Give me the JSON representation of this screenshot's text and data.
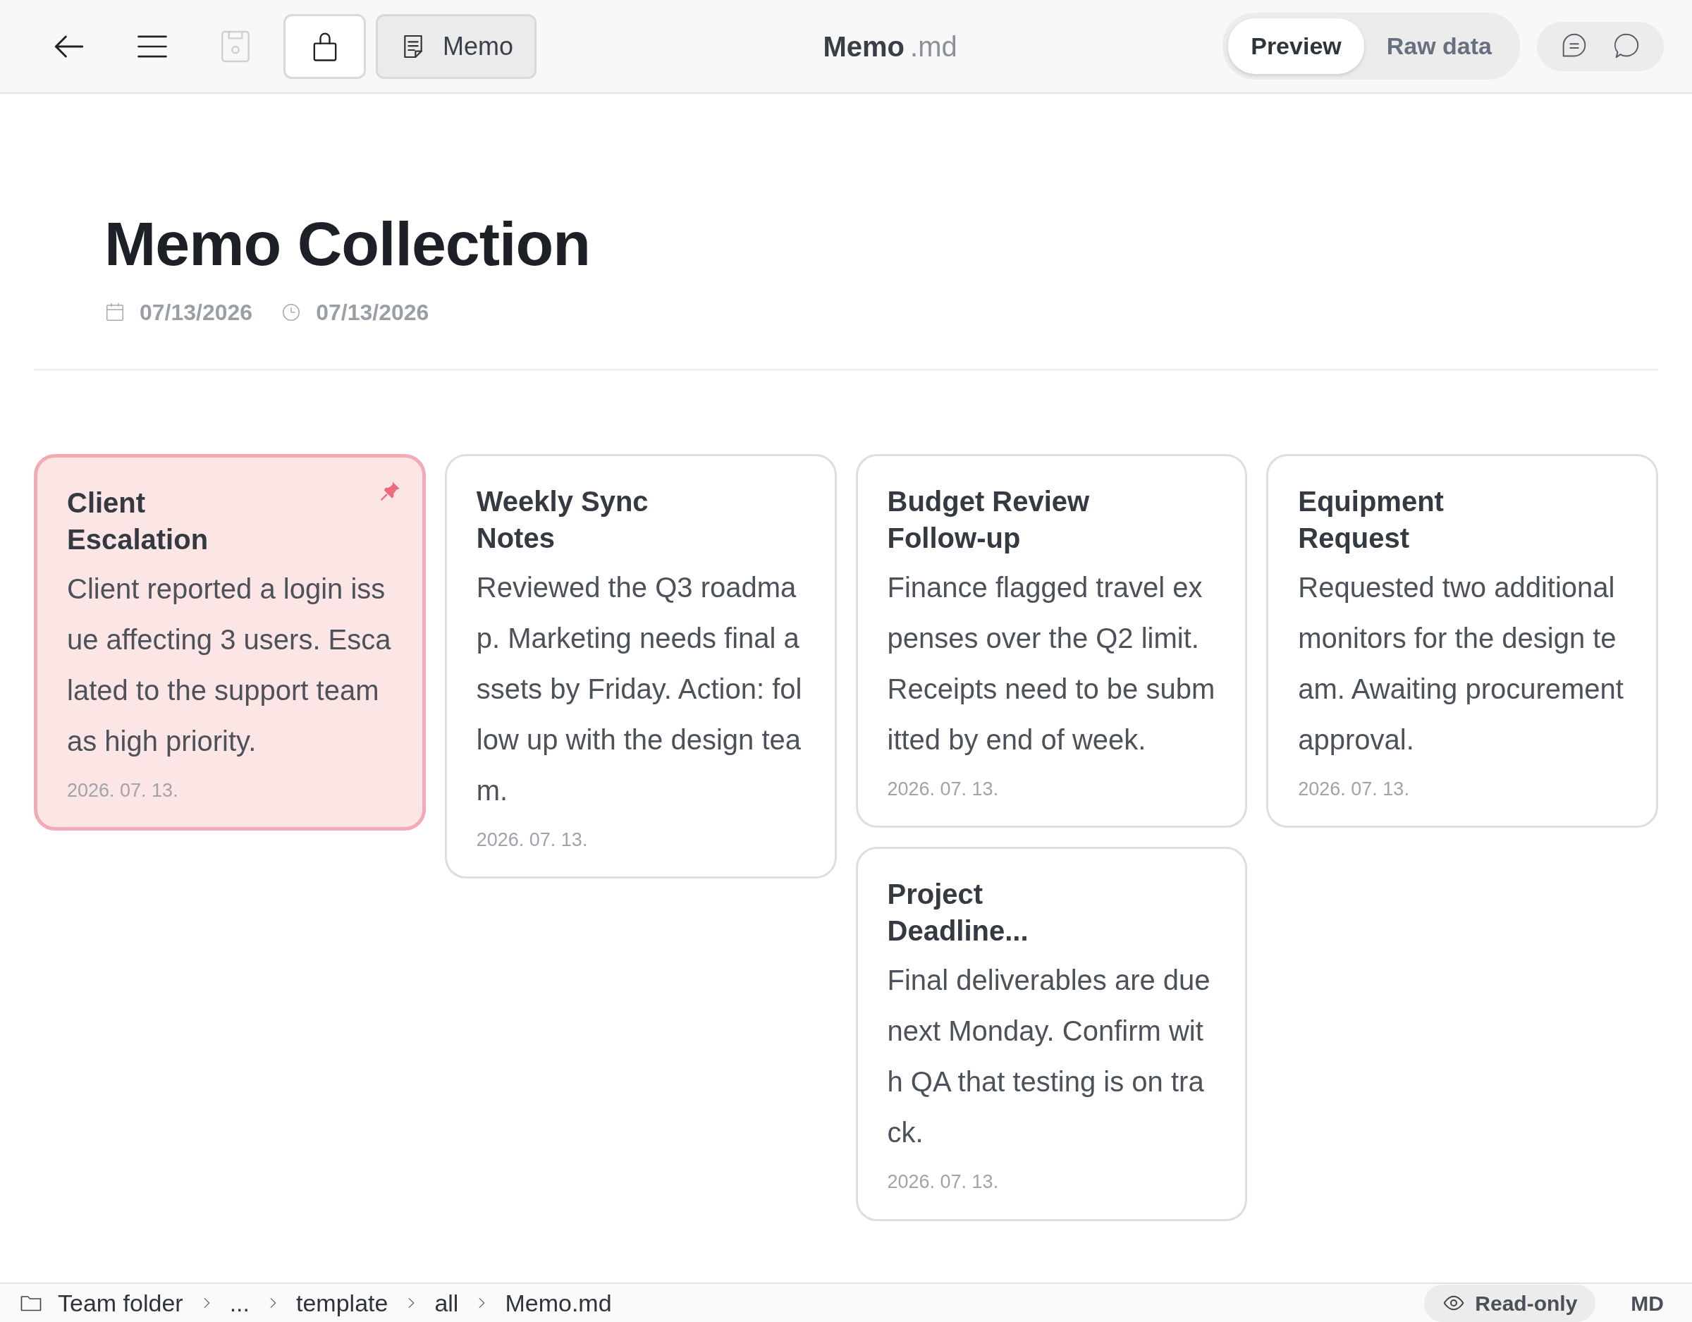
{
  "toolbar": {
    "save_disabled": true,
    "memo_button": "Memo",
    "title": "Memo",
    "extension": ".md",
    "view_tabs": [
      {
        "label": "Preview",
        "selected": true
      },
      {
        "label": "Raw data",
        "selected": false
      }
    ]
  },
  "document": {
    "title": "Memo Collection",
    "created": "07/13/2026",
    "modified": "07/13/2026"
  },
  "memos": [
    {
      "title": "Client Escalation",
      "body": "Client reported a login issue affecting 3 users. Escalated to the support team as high priority.",
      "date": "2026. 07. 13.",
      "pinned": true
    },
    {
      "title": "Weekly Sync Notes",
      "body": "Reviewed the Q3 roadmap. Marketing needs final assets by Friday. Action: follow up with the design team.",
      "date": "2026. 07. 13.",
      "pinned": false
    },
    {
      "title": "Budget Review Follow-up",
      "body": "Finance flagged travel expenses over the Q2 limit. Receipts need to be submitted by end of week.",
      "date": "2026. 07. 13.",
      "pinned": false
    },
    {
      "title": "Equipment Request",
      "body": "Requested two additional monitors for the design team. Awaiting procurement approval.",
      "date": "2026. 07. 13.",
      "pinned": false
    },
    {
      "title": "Project Deadline...",
      "body": "Final deliverables are due next Monday. Confirm with QA that testing is on track.",
      "date": "2026. 07. 13.",
      "pinned": false
    }
  ],
  "status_bar": {
    "breadcrumbs": [
      "Team folder",
      "...",
      "template",
      "all",
      "Memo.md"
    ],
    "badge": "Read-only",
    "format": "MD"
  }
}
